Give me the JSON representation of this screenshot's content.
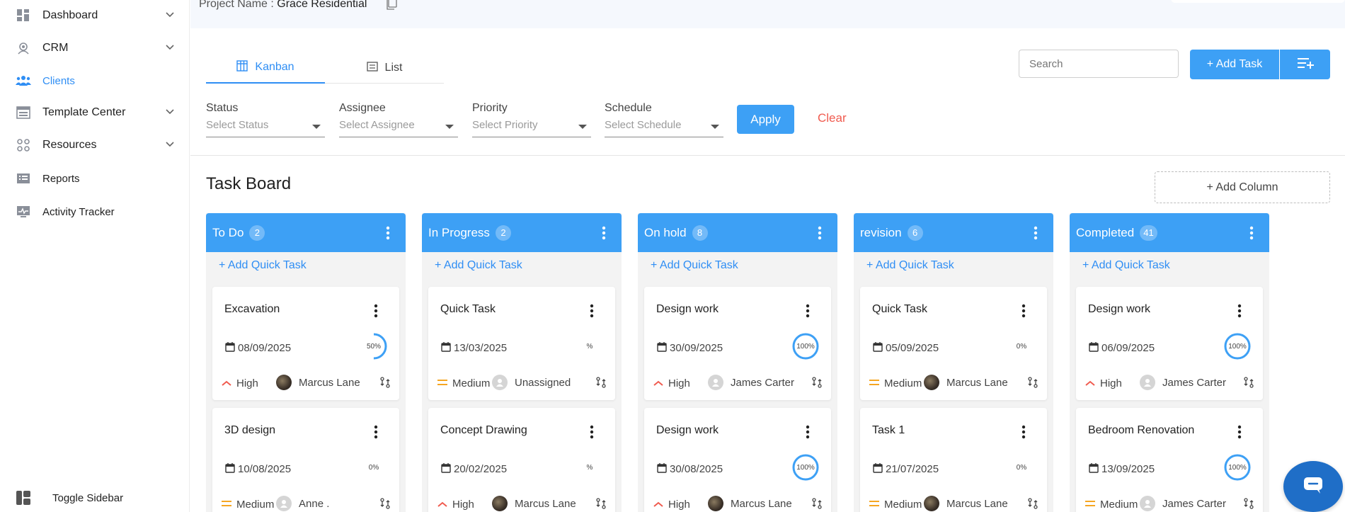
{
  "sidebar": {
    "items": [
      {
        "label": "Dashboard"
      },
      {
        "label": "CRM"
      },
      {
        "label": "Clients"
      },
      {
        "label": "Template Center"
      },
      {
        "label": "Resources"
      },
      {
        "label": "Reports"
      },
      {
        "label": "Activity Tracker"
      }
    ],
    "toggle_label": "Toggle Sidebar"
  },
  "project": {
    "prefix": "Project Name : ",
    "name": "Grace Residential"
  },
  "tabs": [
    {
      "label": "Kanban"
    },
    {
      "label": "List"
    }
  ],
  "search": {
    "placeholder": "Search"
  },
  "add_task_label": "+ Add Task",
  "filters": [
    {
      "label": "Status",
      "placeholder": "Select Status"
    },
    {
      "label": "Assignee",
      "placeholder": "Select Assignee"
    },
    {
      "label": "Priority",
      "placeholder": "Select Priority"
    },
    {
      "label": "Schedule",
      "placeholder": "Select Schedule"
    }
  ],
  "apply_label": "Apply",
  "clear_label": "Clear",
  "board": {
    "title": "Task Board",
    "add_column_label": "+ Add Column",
    "quick_task_label": "+ Add Quick Task"
  },
  "colors": {
    "accent": "#3da0f5",
    "link": "#2f8ef4",
    "danger": "#f05b4f",
    "priority_high": "#f05b4f",
    "priority_medium": "#f5a623"
  },
  "columns": [
    {
      "title": "To Do",
      "count": "2",
      "cards": [
        {
          "title": "Excavation",
          "date": "08/09/2025",
          "progress": "50%",
          "progress_value": 0.5,
          "priority": "High",
          "assignee": "Marcus Lane",
          "avatar": "photo"
        },
        {
          "title": "3D design",
          "date": "10/08/2025",
          "progress": "0%",
          "progress_value": 0,
          "priority": "Medium",
          "assignee": "Anne .",
          "avatar": "blank"
        }
      ]
    },
    {
      "title": "In Progress",
      "count": "2",
      "cards": [
        {
          "title": "Quick Task",
          "date": "13/03/2025",
          "progress": "%",
          "progress_value": 0,
          "priority": "Medium",
          "assignee": "Unassigned",
          "avatar": "blank"
        },
        {
          "title": "Concept Drawing",
          "date": "20/02/2025",
          "progress": "%",
          "progress_value": 0,
          "priority": "High",
          "assignee": "Marcus Lane",
          "avatar": "photo"
        }
      ]
    },
    {
      "title": "On hold",
      "count": "8",
      "cards": [
        {
          "title": "Design work",
          "date": "30/09/2025",
          "progress": "100%",
          "progress_value": 1,
          "priority": "High",
          "assignee": "James Carter",
          "avatar": "blank"
        },
        {
          "title": "Design work",
          "date": "30/08/2025",
          "progress": "100%",
          "progress_value": 1,
          "priority": "High",
          "assignee": "Marcus Lane",
          "avatar": "photo"
        }
      ]
    },
    {
      "title": "revision",
      "count": "6",
      "cards": [
        {
          "title": "Quick Task",
          "date": "05/09/2025",
          "progress": "0%",
          "progress_value": 0,
          "priority": "Medium",
          "assignee": "Marcus Lane",
          "avatar": "photo"
        },
        {
          "title": "Task 1",
          "date": "21/07/2025",
          "progress": "0%",
          "progress_value": 0,
          "priority": "Medium",
          "assignee": "Marcus Lane",
          "avatar": "photo"
        }
      ]
    },
    {
      "title": "Completed",
      "count": "41",
      "cards": [
        {
          "title": "Design work",
          "date": "06/09/2025",
          "progress": "100%",
          "progress_value": 1,
          "priority": "High",
          "assignee": "James Carter",
          "avatar": "blank"
        },
        {
          "title": "Bedroom Renovation",
          "date": "13/09/2025",
          "progress": "100%",
          "progress_value": 1,
          "priority": "Medium",
          "assignee": "James Carter",
          "avatar": "blank"
        }
      ]
    }
  ]
}
